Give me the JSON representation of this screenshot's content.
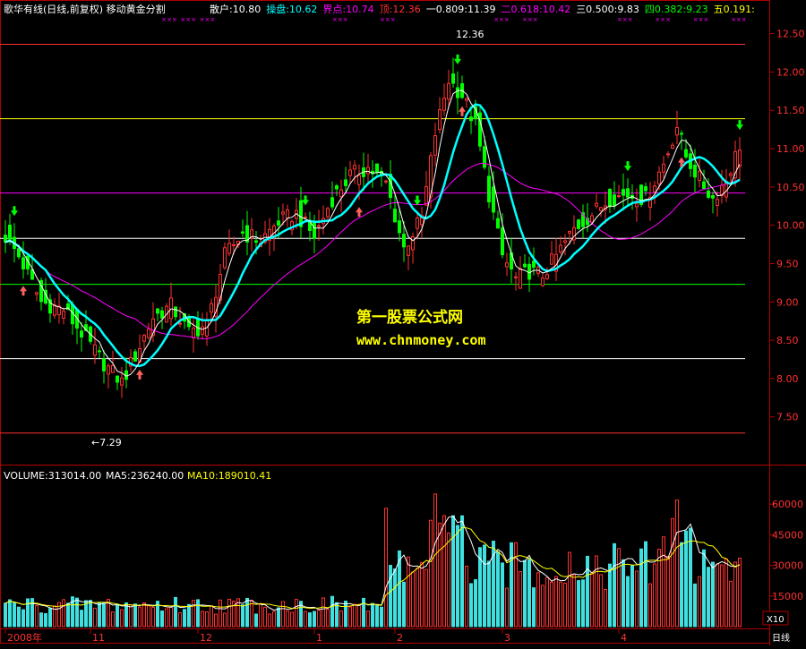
{
  "header": {
    "title": "歌华有线(日线,前复权) 移动黄金分割",
    "levels": [
      {
        "label": "散户:",
        "value": "10.80",
        "color": "#ffffff"
      },
      {
        "label": "操盘:",
        "value": "10.62",
        "color": "#00ffff"
      },
      {
        "label": "界点:",
        "value": "10.74",
        "color": "#ff00ff"
      },
      {
        "label": "顶:",
        "value": "12.36",
        "color": "#ff3030"
      },
      {
        "label": "一0.809:",
        "value": "11.39",
        "color": "#ffffff"
      },
      {
        "label": "二0.618:",
        "value": "10.42",
        "color": "#ff00ff"
      },
      {
        "label": "三0.500:",
        "value": "9.83",
        "color": "#ffffff"
      },
      {
        "label": "四0.382:",
        "value": "9.23",
        "color": "#00ff00"
      },
      {
        "label": "五0.191:",
        "value": "",
        "color": "#ffff00"
      }
    ]
  },
  "price_axis": {
    "ticks": [
      "12.50",
      "12.00",
      "11.50",
      "11.00",
      "10.50",
      "10.00",
      "9.50",
      "9.00",
      "8.50",
      "8.00",
      "7.50"
    ]
  },
  "annotations": {
    "high": "12.36",
    "low": "←7.29"
  },
  "watermark": {
    "line1": "第一股票公式网",
    "line2": "www.chnmoney.com"
  },
  "volume_header": {
    "volume": "VOLUME:313014.00",
    "ma5": "MA5:236240.00",
    "ma10": "MA10:189010.41"
  },
  "volume_axis": {
    "ticks": [
      "60000",
      "45000",
      "30000",
      "15000"
    ],
    "unit": "X10"
  },
  "date_axis": {
    "labels": [
      "2008年",
      "11",
      "12",
      "1",
      "2",
      "3",
      "4"
    ]
  },
  "corner_label": "日线",
  "chart_data": {
    "type": "candlestick",
    "title": "歌华有线(日线,前复权) 移动黄金分割",
    "ylim": [
      7.1,
      12.6
    ],
    "fib_lines": [
      {
        "value": 12.36,
        "color": "#ff3030"
      },
      {
        "value": 11.39,
        "color": "#ffff00"
      },
      {
        "value": 10.42,
        "color": "#ff00ff"
      },
      {
        "value": 9.83,
        "color": "#ffffff"
      },
      {
        "value": 9.23,
        "color": "#00ff00"
      },
      {
        "value": 8.26,
        "color": "#ffffff"
      },
      {
        "value": 7.29,
        "color": "#ff3030"
      }
    ],
    "close_anchors": [
      [
        0,
        9.85
      ],
      [
        3,
        9.6
      ],
      [
        8,
        9.0
      ],
      [
        13,
        8.9
      ],
      [
        17,
        8.6
      ],
      [
        22,
        8.2
      ],
      [
        26,
        7.95
      ],
      [
        29,
        8.3
      ],
      [
        33,
        8.8
      ],
      [
        37,
        8.95
      ],
      [
        41,
        8.6
      ],
      [
        45,
        8.7
      ],
      [
        49,
        9.6
      ],
      [
        53,
        9.9
      ],
      [
        57,
        9.8
      ],
      [
        61,
        10.05
      ],
      [
        65,
        10.15
      ],
      [
        69,
        9.85
      ],
      [
        73,
        10.35
      ],
      [
        77,
        10.65
      ],
      [
        81,
        10.75
      ],
      [
        85,
        10.55
      ],
      [
        89,
        9.7
      ],
      [
        93,
        10.1
      ],
      [
        96,
        11.2
      ],
      [
        99,
        11.9
      ],
      [
        102,
        11.7
      ],
      [
        105,
        11.3
      ],
      [
        108,
        10.4
      ],
      [
        111,
        9.6
      ],
      [
        114,
        9.3
      ],
      [
        117,
        9.4
      ],
      [
        120,
        9.35
      ],
      [
        123,
        9.6
      ],
      [
        127,
        9.95
      ],
      [
        131,
        10.15
      ],
      [
        135,
        10.35
      ],
      [
        139,
        10.4
      ],
      [
        143,
        10.35
      ],
      [
        147,
        10.8
      ],
      [
        150,
        11.3
      ],
      [
        152,
        10.9
      ],
      [
        155,
        10.6
      ],
      [
        158,
        10.35
      ],
      [
        161,
        10.6
      ],
      [
        164,
        11.05
      ]
    ],
    "volume_ylim": [
      0,
      68000
    ],
    "volume_ticks": [
      15000,
      30000,
      45000,
      60000
    ],
    "volume_unit": "X10",
    "buy_signal_days": [
      4,
      30,
      79,
      102,
      151
    ],
    "sell_signal_days": [
      2,
      67,
      92,
      101,
      139,
      164
    ],
    "up_color": "#ff3030",
    "down_color": "#00ff00",
    "ma_colors": {
      "fast": "#ffffff",
      "mid": "#00ffff",
      "slow": "#ff00ff",
      "vol5": "#ffffff",
      "vol10": "#ffff00"
    }
  }
}
